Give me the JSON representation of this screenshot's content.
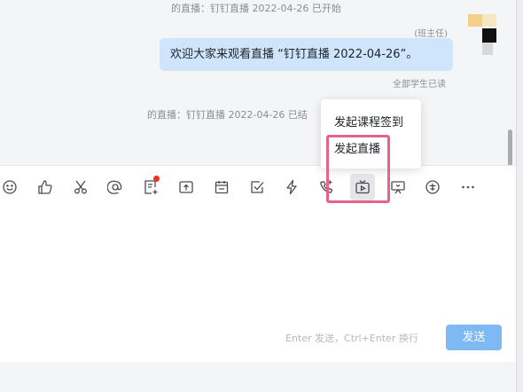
{
  "chat": {
    "system_messages": [
      "的直播：钉钉直播 2022-04-26 已开始",
      "的直播：钉钉直播 2022-04-26 已结"
    ],
    "message": {
      "sender": "(班主任)",
      "text": "欢迎大家来观看直播 “钉钉直播 2022-04-26”。",
      "read_status": "全部学生已读"
    }
  },
  "toolbar": {
    "icons": [
      "emoji-icon",
      "thumbs-up-icon",
      "scissors-icon",
      "at-icon",
      "note-add-icon",
      "upload-icon",
      "calendar-icon",
      "checkbox-icon",
      "lightning-icon",
      "phone-icon",
      "live-tv-icon",
      "projector-icon",
      "campus-icon",
      "more-icon"
    ],
    "active_icon": "live-tv-icon"
  },
  "popup": {
    "items": [
      "发起课程签到",
      "发起直播"
    ]
  },
  "composer": {
    "hint": "Enter 发送，Ctrl+Enter 换行",
    "send_label": "发送"
  },
  "colors": {
    "bubble": "#cfe5fb",
    "send_button": "#7fb9f3",
    "highlight": "#e8638b",
    "red_dot": "#f0301b"
  }
}
